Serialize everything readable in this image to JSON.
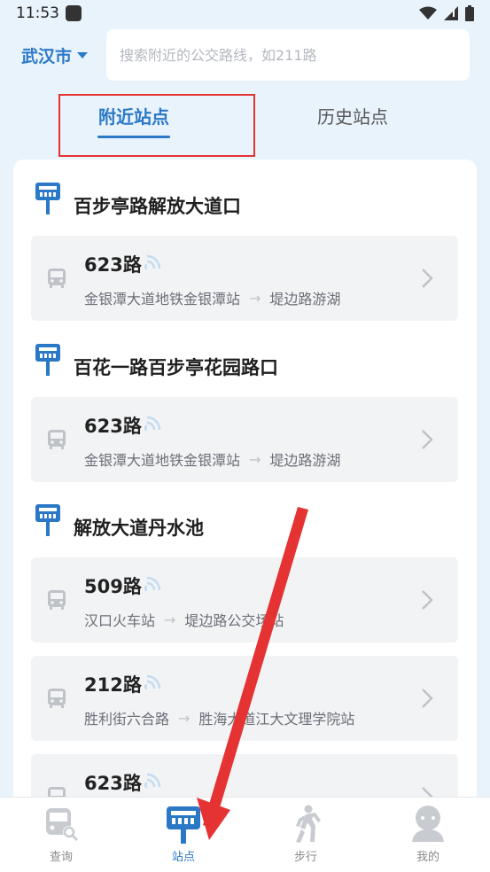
{
  "status_bar": {
    "time": "11:53"
  },
  "header": {
    "city": "武汉市",
    "search_placeholder": "搜索附近的公交路线，如211路"
  },
  "tabs": [
    {
      "label": "附近站点",
      "active": true
    },
    {
      "label": "历史站点",
      "active": false
    }
  ],
  "stops": [
    {
      "name": "百步亭路解放大道口",
      "routes": [
        {
          "name": "623路",
          "from": "金银潭大道地铁金银潭站",
          "to": "堤边路游湖"
        }
      ]
    },
    {
      "name": "百花一路百步亭花园路口",
      "routes": [
        {
          "name": "623路",
          "from": "金银潭大道地铁金银潭站",
          "to": "堤边路游湖"
        }
      ]
    },
    {
      "name": "解放大道丹水池",
      "routes": [
        {
          "name": "509路",
          "from": "汉口火车站",
          "to": "堤边路公交场站"
        },
        {
          "name": "212路",
          "from": "胜利街六合路",
          "to": "胜海大道江大文理学院站"
        },
        {
          "name": "623路",
          "from": "",
          "to": ""
        }
      ]
    }
  ],
  "bottom_nav": [
    {
      "label": "查询",
      "icon": "bus-search-icon",
      "active": false
    },
    {
      "label": "站点",
      "icon": "bus-stop-icon",
      "active": true
    },
    {
      "label": "步行",
      "icon": "walk-icon",
      "active": false
    },
    {
      "label": "我的",
      "icon": "profile-icon",
      "active": false
    }
  ],
  "colors": {
    "accent": "#2b78c7",
    "annotation": "#e53333",
    "background": "#e9f3fc"
  }
}
